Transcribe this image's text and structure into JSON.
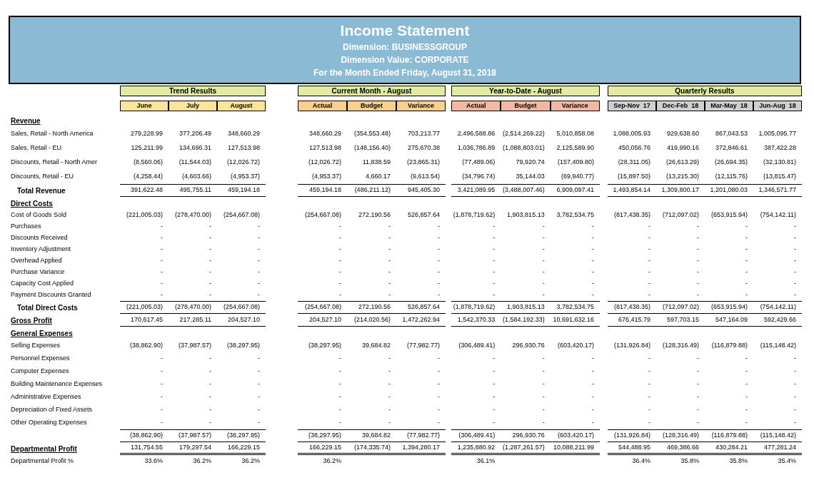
{
  "header": {
    "title": "Income Statement",
    "dimension": "Dimension: BUSINESSGROUP",
    "dimension_value": "Dimension Value: CORPORATE",
    "period": "For the Month Ended Friday, August 31, 2018"
  },
  "column_groups": [
    {
      "title": "Trend Results",
      "color": "#fde49a",
      "columns": [
        "June",
        "July",
        "August"
      ]
    },
    {
      "title": "Current Month - August",
      "color": "#fbcf8e",
      "columns": [
        "Actual",
        "Budget",
        "Variance"
      ]
    },
    {
      "title": "Year-to-Date - August",
      "color": "#f4b8a0",
      "columns": [
        "Actual",
        "Budget",
        "Variance"
      ]
    },
    {
      "title": "Quarterly Results",
      "color": "#d0d0d0",
      "columns": [
        "Sep-Nov  17",
        "Dec-Feb  18",
        "Mar-May  18",
        "Jun-Aug  18"
      ]
    }
  ],
  "rows": [
    {
      "kind": "heading",
      "label": "Revenue"
    },
    {
      "kind": "line",
      "label": "Sales, Retail - North America",
      "values": [
        [
          "279,228.99",
          "377,206.49",
          "348,660.29"
        ],
        [
          "348,660.29",
          "(354,553.48)",
          "703,213.77"
        ],
        [
          "2,496,588.86",
          "(2,514,269.22)",
          "5,010,858.08"
        ],
        [
          "1,088,005.93",
          "929,638.60",
          "867,043.53",
          "1,005,095.77"
        ]
      ]
    },
    {
      "kind": "line",
      "label": "Sales, Retail - EU",
      "values": [
        [
          "125,211.99",
          "134,696.31",
          "127,513.98"
        ],
        [
          "127,513.98",
          "(148,156.40)",
          "275,670.38"
        ],
        [
          "1,036,786.89",
          "(1,088,803.01)",
          "2,125,589.90"
        ],
        [
          "450,056.76",
          "419,990.16",
          "372,846.61",
          "387,422.28"
        ]
      ]
    },
    {
      "kind": "line",
      "label": "Discounts, Retail - North Amer",
      "values": [
        [
          "(8,560.06)",
          "(11,544.03)",
          "(12,026.72)"
        ],
        [
          "(12,026.72)",
          "11,838.59",
          "(23,865.31)"
        ],
        [
          "(77,489.06)",
          "79,920.74",
          "(157,409.80)"
        ],
        [
          "(28,311.05)",
          "(26,613.29)",
          "(26,694.35)",
          "(32,130.81)"
        ]
      ]
    },
    {
      "kind": "line",
      "label": "Discounts, Retail - EU",
      "values": [
        [
          "(4,258.44)",
          "(4,603.66)",
          "(4,953.37)"
        ],
        [
          "(4,953.37)",
          "4,660.17",
          "(9,613.54)"
        ],
        [
          "(34,796.74)",
          "35,144.03",
          "(69,940.77)"
        ],
        [
          "(15,897.50)",
          "(13,215.30)",
          "(12,115.76)",
          "(13,815.47)"
        ]
      ]
    },
    {
      "kind": "total",
      "label": "Total Revenue",
      "values": [
        [
          "391,622.48",
          "495,755.11",
          "459,194.18"
        ],
        [
          "459,194.18",
          "(486,211.12)",
          "945,405.30"
        ],
        [
          "3,421,089.95",
          "(3,488,007.46)",
          "6,909,097.41"
        ],
        [
          "1,493,854.14",
          "1,309,800.17",
          "1,201,080.03",
          "1,346,571.77"
        ]
      ]
    },
    {
      "kind": "heading",
      "label": "Direct Costs"
    },
    {
      "kind": "line",
      "label": "Cost of Goods Sold",
      "values": [
        [
          "(221,005.03)",
          "(278,470.00)",
          "(254,667.08)"
        ],
        [
          "(254,667.08)",
          "272,190.56",
          "526,857.64"
        ],
        [
          "(1,878,719.62)",
          "1,903,815.13",
          "3,782,534.75"
        ],
        [
          "(817,438.35)",
          "(712,097.02)",
          "(653,915.94)",
          "(754,142.11)"
        ]
      ]
    },
    {
      "kind": "line",
      "label": "Purchases",
      "values": [
        [
          "-",
          "-",
          "-"
        ],
        [
          "-",
          "-",
          "-"
        ],
        [
          "-",
          "-",
          "-"
        ],
        [
          "-",
          "-",
          "-",
          "-"
        ]
      ]
    },
    {
      "kind": "line",
      "label": "Discounts Received",
      "values": [
        [
          "-",
          "-",
          "-"
        ],
        [
          "-",
          "-",
          "-"
        ],
        [
          "-",
          "-",
          "-"
        ],
        [
          "-",
          "-",
          "-",
          "-"
        ]
      ]
    },
    {
      "kind": "line",
      "label": "Inventory Adjustment",
      "values": [
        [
          "-",
          "-",
          "-"
        ],
        [
          "-",
          "-",
          "-"
        ],
        [
          "-",
          "-",
          "-"
        ],
        [
          "-",
          "-",
          "-",
          "-"
        ]
      ]
    },
    {
      "kind": "line",
      "label": "Overhead Applied",
      "values": [
        [
          "-",
          "-",
          "-"
        ],
        [
          "-",
          "-",
          "-"
        ],
        [
          "-",
          "-",
          "-"
        ],
        [
          "-",
          "-",
          "-",
          "-"
        ]
      ]
    },
    {
      "kind": "line",
      "label": "Purchase Variance",
      "values": [
        [
          "-",
          "-",
          "-"
        ],
        [
          "-",
          "-",
          "-"
        ],
        [
          "-",
          "-",
          "-"
        ],
        [
          "-",
          "-",
          "-",
          "-"
        ]
      ]
    },
    {
      "kind": "line",
      "label": "Capacity Cost Applied",
      "values": [
        [
          "-",
          "-",
          "-"
        ],
        [
          "-",
          "-",
          "-"
        ],
        [
          "-",
          "-",
          "-"
        ],
        [
          "-",
          "-",
          "-",
          "-"
        ]
      ]
    },
    {
      "kind": "line",
      "label": "Payment Discounts Granted",
      "values": [
        [
          "-",
          "-",
          "-"
        ],
        [
          "-",
          "-",
          "-"
        ],
        [
          "-",
          "-",
          "-"
        ],
        [
          "-",
          "-",
          "-",
          "-"
        ]
      ]
    },
    {
      "kind": "total",
      "label": "Total Direct Costs",
      "values": [
        [
          "(221,005.03)",
          "(278,470.00)",
          "(254,667.08)"
        ],
        [
          "(254,667.08)",
          "272,190.56",
          "526,857.64"
        ],
        [
          "(1,878,719.62)",
          "1,903,815.13",
          "3,782,534.75"
        ],
        [
          "(817,438.35)",
          "(712,097.02)",
          "(653,915.94)",
          "(754,142.11)"
        ]
      ]
    },
    {
      "kind": "gross",
      "label": "Gross Profit",
      "values": [
        [
          "170,617.45",
          "217,285.11",
          "204,527.10"
        ],
        [
          "204,527.10",
          "(214,020.56)",
          "1,472,262.94"
        ],
        [
          "1,542,370.33",
          "(1,584,192.33)",
          "10,691,632.16"
        ],
        [
          "676,415.79",
          "597,703.15",
          "547,164.09",
          "592,429.66"
        ]
      ]
    },
    {
      "kind": "heading",
      "label": "General Expenses"
    },
    {
      "kind": "line",
      "label": "Selling Expenses",
      "values": [
        [
          "(38,862.90)",
          "(37,987.57)",
          "(38,297.95)"
        ],
        [
          "(38,297.95)",
          "39,684.82",
          "(77,982.77)"
        ],
        [
          "(306,489.41)",
          "296,930.76",
          "(603,420.17)"
        ],
        [
          "(131,926.84)",
          "(128,316.49)",
          "(116,879.88)",
          "(115,148.42)"
        ]
      ]
    },
    {
      "kind": "line",
      "label": "Personnel Expenses",
      "values": [
        [
          "-",
          "-",
          "-"
        ],
        [
          "-",
          "-",
          "-"
        ],
        [
          "-",
          "-",
          "-"
        ],
        [
          "-",
          "-",
          "-",
          "-"
        ]
      ]
    },
    {
      "kind": "line",
      "label": "Computer Expenses",
      "values": [
        [
          "-",
          "-",
          "-"
        ],
        [
          "-",
          "-",
          "-"
        ],
        [
          "-",
          "-",
          "-"
        ],
        [
          "-",
          "-",
          "-",
          "-"
        ]
      ]
    },
    {
      "kind": "line",
      "label": "Building Maintenance Expenses",
      "values": [
        [
          "-",
          "-",
          "-"
        ],
        [
          "-",
          "-",
          "-"
        ],
        [
          "-",
          "-",
          "-"
        ],
        [
          "-",
          "-",
          "-",
          "-"
        ]
      ]
    },
    {
      "kind": "line",
      "label": "Administrative Expenses",
      "values": [
        [
          "-",
          "-",
          "-"
        ],
        [
          "-",
          "-",
          "-"
        ],
        [
          "-",
          "-",
          "-"
        ],
        [
          "-",
          "-",
          "-",
          "-"
        ]
      ]
    },
    {
      "kind": "line",
      "label": "Depreciation of Fixed Assets",
      "values": [
        [
          "-",
          "-",
          "-"
        ],
        [
          "-",
          "-",
          "-"
        ],
        [
          "-",
          "-",
          "-"
        ],
        [
          "-",
          "-",
          "-",
          "-"
        ]
      ]
    },
    {
      "kind": "line",
      "label": "Other Operating Expenses",
      "values": [
        [
          "-",
          "-",
          "-"
        ],
        [
          "-",
          "-",
          "-"
        ],
        [
          "-",
          "-",
          "-"
        ],
        [
          "-",
          "-",
          "-",
          "-"
        ]
      ]
    },
    {
      "kind": "subtotal",
      "values": [
        [
          "(38,862.90)",
          "(37,987.57)",
          "(38,297.95)"
        ],
        [
          "(38,297.95)",
          "39,684.82",
          "(77,982.77)"
        ],
        [
          "(306,489.41)",
          "296,930.76",
          "(603,420.17)"
        ],
        [
          "(131,926.84)",
          "(128,316.49)",
          "(116,879.88)",
          "(115,148.42)"
        ]
      ]
    },
    {
      "kind": "profit",
      "label": "Departmental Profit",
      "values": [
        [
          "131,754.55",
          "179,297.54",
          "166,229.15"
        ],
        [
          "166,229.15",
          "(174,335.74)",
          "1,394,280.17"
        ],
        [
          "1,235,880.92",
          "(1,287,261.57)",
          "10,088,211.99"
        ],
        [
          "544,488.95",
          "469,386.66",
          "430,284.21",
          "477,281.24"
        ]
      ]
    },
    {
      "kind": "percent",
      "label": "Departmental Profit %",
      "values": [
        [
          "33.6%",
          "36.2%",
          "36.2%"
        ],
        [
          "36.2%"
        ],
        [
          "36.1%"
        ],
        [
          "36.4%",
          "35.8%",
          "35.8%",
          "35.4%"
        ]
      ]
    }
  ]
}
